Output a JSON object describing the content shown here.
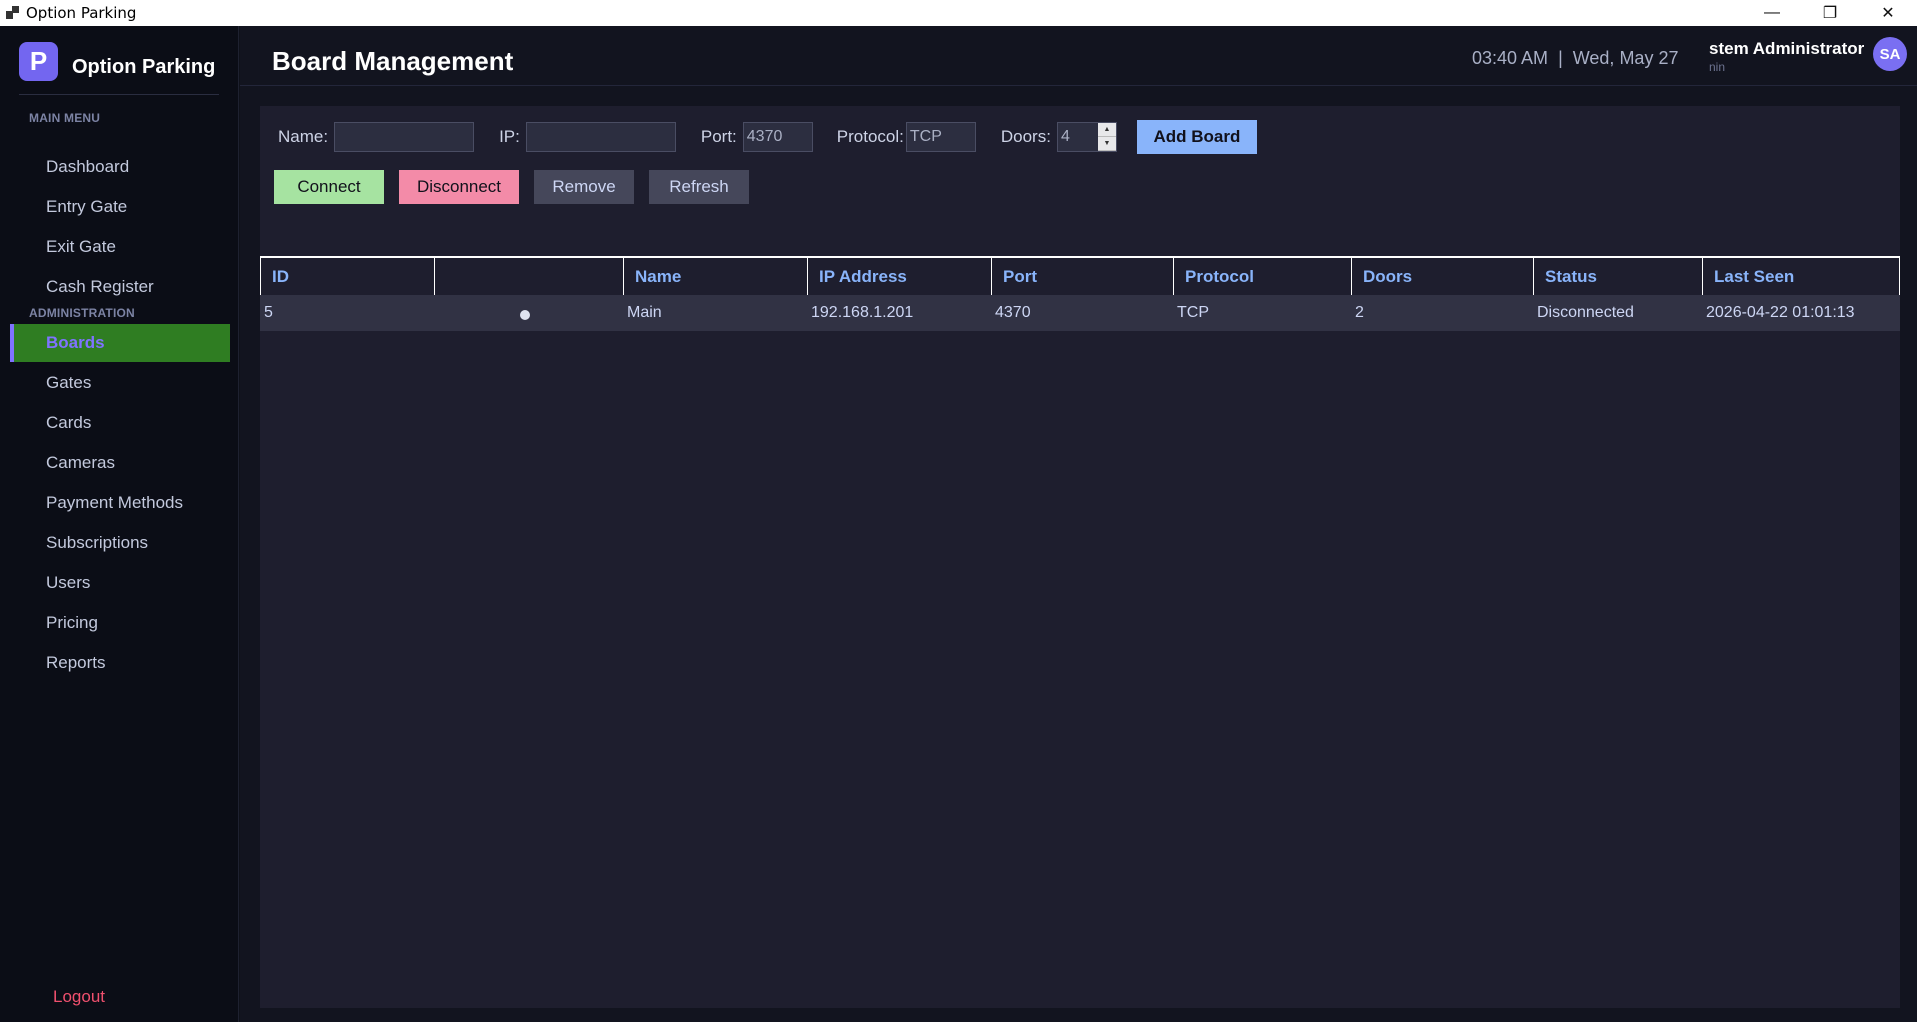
{
  "window": {
    "title": "Option Parking",
    "minimize": "—",
    "restore": "❐",
    "close": "✕"
  },
  "sidebar": {
    "logo_letter": "P",
    "brand": "Option Parking",
    "main_menu_label": "MAIN MENU",
    "main_items": [
      "Dashboard",
      "Entry Gate",
      "Exit Gate",
      "Cash Register"
    ],
    "admin_label": "ADMINISTRATION",
    "admin_items": [
      "Boards",
      "Gates",
      "Cards",
      "Cameras",
      "Payment Methods",
      "Subscriptions",
      "Users",
      "Pricing",
      "Reports"
    ],
    "active_item": "Boards",
    "logout": "Logout"
  },
  "header": {
    "title": "Board Management",
    "time": "03:40 AM",
    "separator": "|",
    "date": "Wed, May 27",
    "user_name": "stem Administrator",
    "user_role": "nin",
    "avatar_initials": "SA"
  },
  "form": {
    "name_label": "Name:",
    "name_value": "",
    "ip_label": "IP:",
    "ip_value": "",
    "port_label": "Port:",
    "port_value": "4370",
    "protocol_label": "Protocol:",
    "protocol_value": "TCP",
    "doors_label": "Doors:",
    "doors_value": "4",
    "add_button": "Add Board"
  },
  "actions": {
    "connect": "Connect",
    "disconnect": "Disconnect",
    "remove": "Remove",
    "refresh": "Refresh"
  },
  "table": {
    "columns": [
      "ID",
      "",
      "Name",
      "IP Address",
      "Port",
      "Protocol",
      "Doors",
      "Status",
      "Last Seen"
    ],
    "rows": [
      {
        "id": "5",
        "indicator": "dot",
        "name": "Main",
        "ip": "192.168.1.201",
        "port": "4370",
        "protocol": "TCP",
        "doors": "2",
        "status": "Disconnected",
        "last_seen": "2026-04-22 01:01:13"
      }
    ]
  },
  "colors": {
    "accent": "#7f73ff",
    "active_bg": "#2f7d22",
    "connect": "#a6e3a1",
    "disconnect": "#f38ba8",
    "add": "#89b4fa",
    "logout": "#f0506e"
  }
}
